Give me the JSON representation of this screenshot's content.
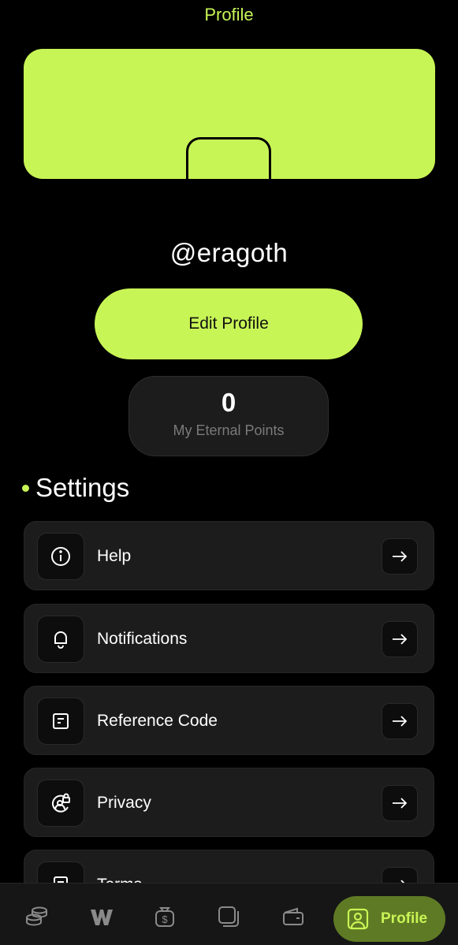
{
  "header": {
    "title": "Profile"
  },
  "profile": {
    "username": "@eragoth",
    "edit_label": "Edit Profile",
    "points_value": "0",
    "points_label": "My Eternal Points"
  },
  "settings": {
    "heading": "Settings",
    "items": [
      {
        "label": "Help",
        "icon": "info-icon"
      },
      {
        "label": "Notifications",
        "icon": "bell-icon"
      },
      {
        "label": "Reference Code",
        "icon": "document-icon"
      },
      {
        "label": "Privacy",
        "icon": "privacy-lock-icon"
      },
      {
        "label": "Terms",
        "icon": "terms-document-icon"
      }
    ]
  },
  "nav": {
    "items": [
      "coins-icon",
      "brand-logo-icon",
      "money-bag-icon",
      "cards-icon",
      "wallet-icon"
    ],
    "active_label": "Profile",
    "active_icon": "profile-icon"
  },
  "colors": {
    "accent": "#c8f556",
    "background": "#000000",
    "card": "#1c1c1c",
    "muted": "#7a7a7a"
  }
}
